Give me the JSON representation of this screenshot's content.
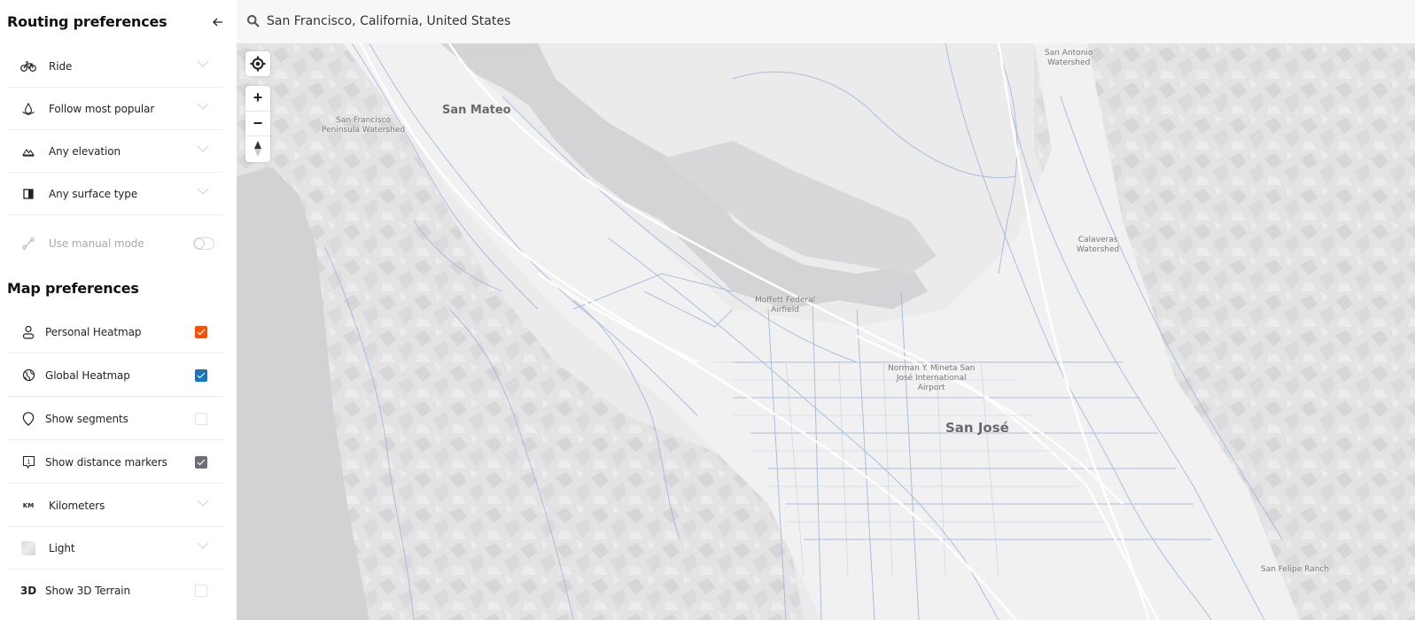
{
  "sidebar": {
    "routing_title": "Routing preferences",
    "collapse_icon": "arrow-left-icon",
    "routing_items": [
      {
        "icon": "bike-icon",
        "label": "Ride",
        "type": "dropdown"
      },
      {
        "icon": "popularity-icon",
        "label": "Follow most popular",
        "type": "dropdown"
      },
      {
        "icon": "elevation-icon",
        "label": "Any elevation",
        "type": "dropdown"
      },
      {
        "icon": "surface-icon",
        "label": "Any surface type",
        "type": "dropdown"
      },
      {
        "icon": "manual-route-icon",
        "label": "Use manual mode",
        "type": "toggle",
        "enabled": false,
        "disabled": true
      }
    ],
    "map_title": "Map preferences",
    "map_items": [
      {
        "icon": "person-icon",
        "label": "Personal Heatmap",
        "type": "checkbox",
        "checked": true,
        "color": "#fc5200"
      },
      {
        "icon": "globe-icon",
        "label": "Global Heatmap",
        "type": "checkbox",
        "checked": true,
        "color": "#1a74b8"
      },
      {
        "icon": "segment-pin-icon",
        "label": "Show segments",
        "type": "checkbox",
        "checked": false
      },
      {
        "icon": "distance-marker-icon",
        "label": "Show distance markers",
        "type": "checkbox",
        "checked": true,
        "color": "#6d6d78"
      },
      {
        "icon": "km-icon",
        "icon_text": "KM",
        "label": "Kilometers",
        "type": "dropdown"
      },
      {
        "icon": "map-style-thumbnail-icon",
        "label": "Light",
        "type": "dropdown"
      },
      {
        "icon": "3d-icon",
        "icon_text": "3D",
        "label": "Show 3D Terrain",
        "type": "checkbox",
        "checked": false
      }
    ]
  },
  "search": {
    "icon": "search-icon",
    "value": "San Francisco, California, United States",
    "placeholder": "Search"
  },
  "map": {
    "controls": {
      "locate": "locate-icon",
      "zoom_in": "+",
      "zoom_out": "−",
      "compass": "compass-icon"
    },
    "labels": [
      {
        "id": "san-mateo",
        "text": "San Mateo",
        "size": "med"
      },
      {
        "id": "sf-watershed",
        "text": "San Francisco\nPeninsula Watershed",
        "size": "small"
      },
      {
        "id": "moffett",
        "text": "Moffett Federal\nAirfield",
        "size": "small"
      },
      {
        "id": "sjc",
        "text": "Norman Y. Mineta San\nJosé International\nAirport",
        "size": "small"
      },
      {
        "id": "san-jose",
        "text": "San José",
        "size": "big"
      },
      {
        "id": "san-antonio",
        "text": "San Antonio\nWatershed",
        "size": "small"
      },
      {
        "id": "calaveras",
        "text": "Calaveras\nWatershed",
        "size": "small"
      },
      {
        "id": "san-felipe",
        "text": "San Felipe Ranch",
        "size": "small"
      }
    ],
    "colors": {
      "water": "#d4d4d6",
      "land": "#ececed",
      "hills": "#dcdcde",
      "road": "#ffffff",
      "heat": "#8aa6cf"
    }
  }
}
